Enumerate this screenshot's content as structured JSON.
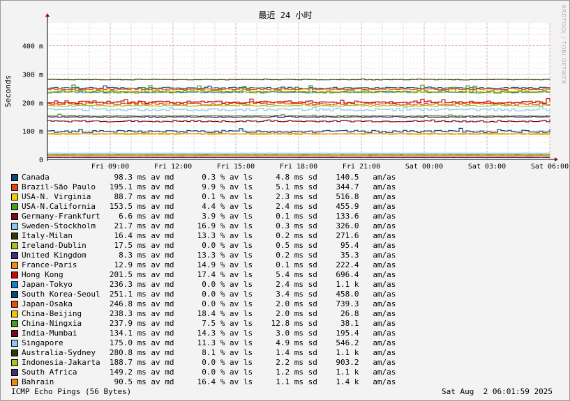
{
  "watermark": "RRDTOOL / TOBI OETIKER",
  "footer": {
    "left": "ICMP Echo Pings (56 Bytes)",
    "right": "Sat Aug  2 06:01:59 2025"
  },
  "chart_data": {
    "type": "line",
    "title": "最近 24 小时",
    "ylabel": "Seconds",
    "ylim": [
      0,
      480
    ],
    "y_ticks": [
      {
        "value": 0,
        "label": "0"
      },
      {
        "value": 100,
        "label": "100 m"
      },
      {
        "value": 200,
        "label": "200 m"
      },
      {
        "value": 300,
        "label": "300 m"
      },
      {
        "value": 400,
        "label": "400 m"
      }
    ],
    "xlim": [
      "Fri 06:00",
      "Sat 06:00"
    ],
    "x_ticks": [
      {
        "hour": 3,
        "label": "Fri 09:00"
      },
      {
        "hour": 6,
        "label": "Fri 12:00"
      },
      {
        "hour": 9,
        "label": "Fri 15:00"
      },
      {
        "hour": 12,
        "label": "Fri 18:00"
      },
      {
        "hour": 15,
        "label": "Fri 21:00"
      },
      {
        "hour": 18,
        "label": "Sat 00:00"
      },
      {
        "hour": 21,
        "label": "Sat 03:00"
      },
      {
        "hour": 24,
        "label": "Sat 06:00"
      }
    ],
    "grid": true,
    "series": [
      {
        "name": "Canada",
        "color": "#0b4a7a",
        "avg": "98.3",
        "loss": "0.3",
        "sd": "4.8",
        "amas": "140.5"
      },
      {
        "name": "Brazil-São Paulo",
        "color": "#e8420e",
        "avg": "195.1",
        "loss": "9.9",
        "sd": "5.1",
        "amas": "344.7"
      },
      {
        "name": "USA-N. Virginia",
        "color": "#f5cc00",
        "avg": "88.7",
        "loss": "0.1",
        "sd": "2.3",
        "amas": "516.8"
      },
      {
        "name": "USA-N.California",
        "color": "#4c9a1e",
        "avg": "153.5",
        "loss": "4.4",
        "sd": "2.4",
        "amas": "455.9"
      },
      {
        "name": "Germany-Frankfurt",
        "color": "#7b0a1e",
        "avg": "6.6",
        "loss": "3.9",
        "sd": "0.1",
        "amas": "133.6"
      },
      {
        "name": "Sweden-Stockholm",
        "color": "#8ec6ee",
        "avg": "21.7",
        "loss": "16.9",
        "sd": "0.3",
        "amas": "326.0"
      },
      {
        "name": "Italy-Milan",
        "color": "#2e3a06",
        "avg": "16.4",
        "loss": "13.3",
        "sd": "0.2",
        "amas": "271.6"
      },
      {
        "name": "Ireland-Dublin",
        "color": "#a8c41c",
        "avg": "17.5",
        "loss": "0.0",
        "sd": "0.5",
        "amas": "95.4"
      },
      {
        "name": "United Kingdom",
        "color": "#4a2a7a",
        "avg": "8.3",
        "loss": "13.3",
        "sd": "0.2",
        "amas": "35.3"
      },
      {
        "name": "France-Paris",
        "color": "#ee8a10",
        "avg": "12.9",
        "loss": "14.9",
        "sd": "0.1",
        "amas": "222.4"
      },
      {
        "name": "Hong Kong",
        "color": "#c40a0a",
        "avg": "201.5",
        "loss": "17.4",
        "sd": "5.4",
        "amas": "696.4"
      },
      {
        "name": "Japan-Tokyo",
        "color": "#1a7ec8",
        "avg": "236.3",
        "loss": "0.0",
        "sd": "2.4",
        "amas": "1.1 k"
      },
      {
        "name": "South Korea-Seoul",
        "color": "#0a4a7a",
        "avg": "251.1",
        "loss": "0.0",
        "sd": "3.4",
        "amas": "458.0"
      },
      {
        "name": "Japan-Osaka",
        "color": "#f04a10",
        "avg": "246.8",
        "loss": "0.0",
        "sd": "2.0",
        "amas": "739.3"
      },
      {
        "name": "China-Beijing",
        "color": "#f5c400",
        "avg": "238.3",
        "loss": "18.4",
        "sd": "2.0",
        "amas": "26.8"
      },
      {
        "name": "China-Ningxia",
        "color": "#4a9a1e",
        "avg": "237.9",
        "loss": "7.5",
        "sd": "12.8",
        "amas": "38.1"
      },
      {
        "name": "India-Mumbai",
        "color": "#7a0a1a",
        "avg": "134.1",
        "loss": "14.3",
        "sd": "3.0",
        "amas": "195.4"
      },
      {
        "name": "Singapore",
        "color": "#8ec6ee",
        "avg": "175.0",
        "loss": "11.3",
        "sd": "4.9",
        "amas": "546.2"
      },
      {
        "name": "Australia-Sydney",
        "color": "#2e3a06",
        "avg": "280.8",
        "loss": "8.1",
        "sd": "1.4",
        "amas": "1.1 k"
      },
      {
        "name": "Indonesia-Jakarta",
        "color": "#a8c41c",
        "avg": "188.7",
        "loss": "0.0",
        "sd": "2.2",
        "amas": "903.2"
      },
      {
        "name": "South Africa",
        "color": "#4a2a7a",
        "avg": "149.2",
        "loss": "0.0",
        "sd": "1.2",
        "amas": "1.1 k"
      },
      {
        "name": "Bahrain",
        "color": "#ee8a10",
        "avg": "90.5",
        "loss": "16.4",
        "sd": "1.1",
        "amas": "1.4 k"
      }
    ]
  }
}
